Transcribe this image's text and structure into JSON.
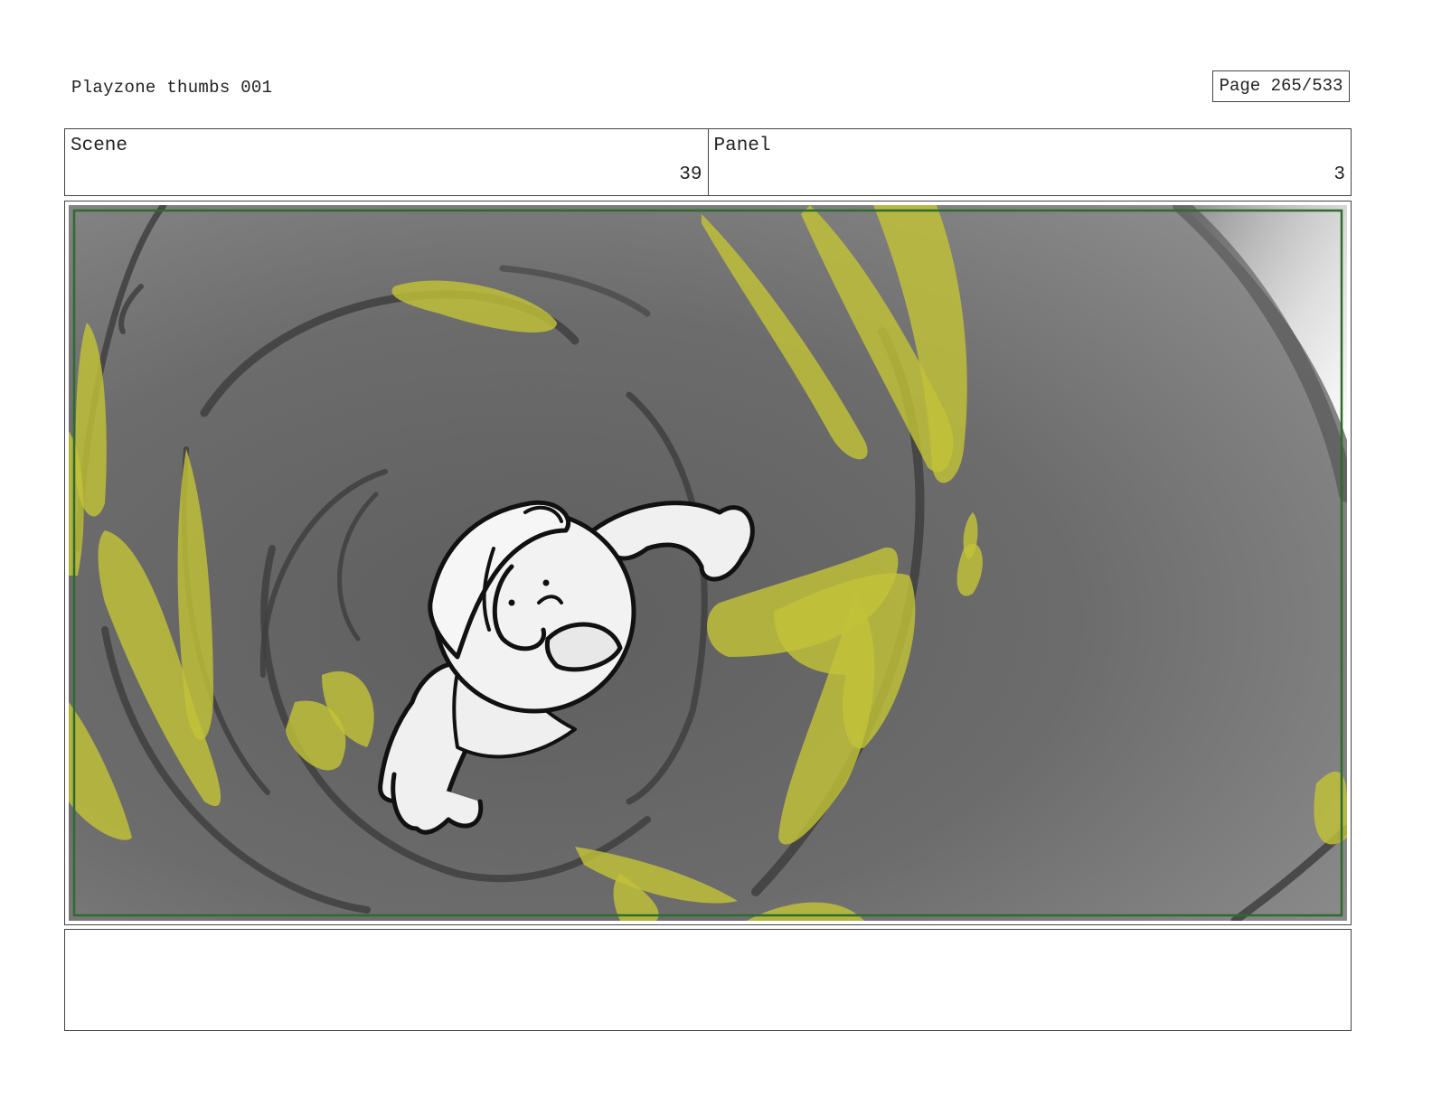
{
  "header": {
    "document_title": "Playzone thumbs 001",
    "page_label": "Page 265/533"
  },
  "info": {
    "scene_label": "Scene",
    "scene_value": "39",
    "panel_label": "Panel",
    "panel_value": "3"
  },
  "colors": {
    "slime_yellow": "#c2c238",
    "tunnel_gray": "#6f6f6f",
    "safe_frame_green": "#2e6b2e"
  }
}
